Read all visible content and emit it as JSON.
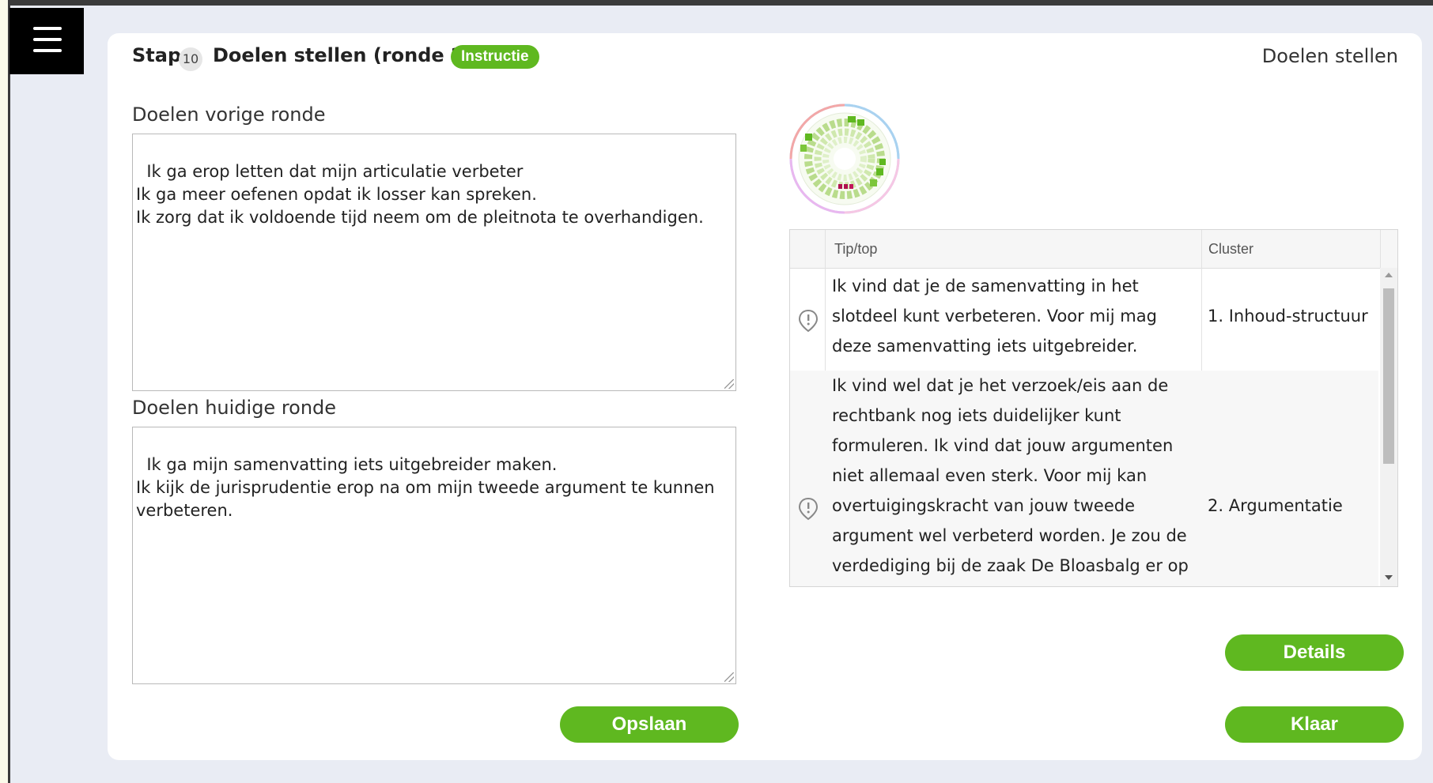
{
  "header": {
    "step_label": "Stap",
    "step_number": "10",
    "title": "Doelen stellen (ronde 2)",
    "instruction_badge": "Instructie",
    "page_name": "Doelen stellen"
  },
  "previous_goals": {
    "label": "Doelen vorige ronde",
    "text": "Ik ga erop letten dat mijn articulatie verbeter\nIk ga meer oefenen opdat ik losser kan spreken.\nIk zorg dat ik voldoende tijd neem om de pleitnota te overhandigen."
  },
  "current_goals": {
    "label": "Doelen huidige ronde",
    "text": "Ik ga mijn samenvatting iets uitgebreider maken.\nIk kijk de jurisprudentie erop na om mijn tweede argument te kunnen verbeteren."
  },
  "buttons": {
    "save": "Opslaan",
    "details": "Details",
    "done": "Klaar"
  },
  "feedback_table": {
    "columns": [
      "Tip/top",
      "Cluster"
    ],
    "rows": [
      {
        "icon": "tip-marker-icon",
        "tip": "Ik vind dat je de samenvatting in het slotdeel kunt verbeteren. Voor mij mag deze samenvatting iets uitgebreider.",
        "cluster": "1. Inhoud-structuur"
      },
      {
        "icon": "tip-marker-icon",
        "tip": "Ik vind wel dat je het verzoek/eis aan de rechtbank nog iets duidelijker kunt formuleren. Ik vind dat jouw argumenten niet allemaal even sterk. Voor mij kan overtuigingskracht van jouw tweede argument wel verbeterd worden. Je zou de verdediging bij de zaak De Bloasbalg er op",
        "cluster": "2. Argumentatie"
      }
    ]
  },
  "colors": {
    "accent_green": "#5fb820",
    "menu_bg": "#000000"
  }
}
